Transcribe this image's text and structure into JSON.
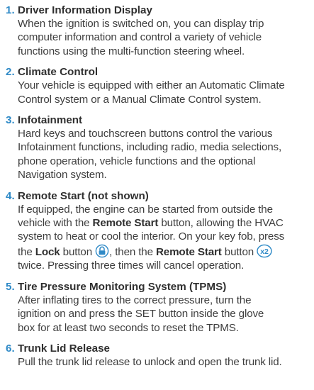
{
  "items": [
    {
      "number": "1.",
      "title": "Driver Information Display",
      "lines": [
        "When the ignition is switched on, you can display trip",
        "computer information and control a variety of vehicle",
        "functions using the multi-function steering wheel."
      ]
    },
    {
      "number": "2.",
      "title": "Climate Control",
      "lines": [
        "Your vehicle is equipped with either an Automatic Climate",
        "Control system or a Manual Climate Control system."
      ]
    },
    {
      "number": "3.",
      "title": "Infotainment",
      "lines": [
        "Hard keys and touchscreen buttons control the various",
        "Infotainment functions, including radio, media selections,",
        "phone operation, vehicle functions and the optional",
        "Navigation system."
      ]
    },
    {
      "number": "4.",
      "title": "Remote Start (not shown)",
      "line1": "If equipped, the engine can be started from outside the",
      "line2_a": "vehicle with the ",
      "line2_b": "Remote Start",
      "line2_c": " button, allowing the HVAC",
      "line3": "system to heat or cool the interior. On your key fob, press",
      "line4_a": "the ",
      "line4_b": "Lock",
      "line4_c": " button ",
      "line4_d": ", then the ",
      "line4_e": "Remote Start",
      "line4_f": " button ",
      "x2_label": "x2",
      "line5": "twice. Pressing three times will cancel operation."
    },
    {
      "number": "5.",
      "title": "Tire Pressure Monitoring System (TPMS)",
      "lines": [
        "After inflating tires to the correct pressure, turn the",
        "ignition on and press the SET button inside the glove",
        "box for at least two seconds to reset the TPMS."
      ]
    },
    {
      "number": "6.",
      "title": "Trunk Lid Release",
      "lines": [
        "Pull the trunk lid release to unlock and open the trunk lid."
      ]
    }
  ],
  "colors": {
    "accent": "#2f8ac7",
    "text": "#3e3e3e"
  }
}
